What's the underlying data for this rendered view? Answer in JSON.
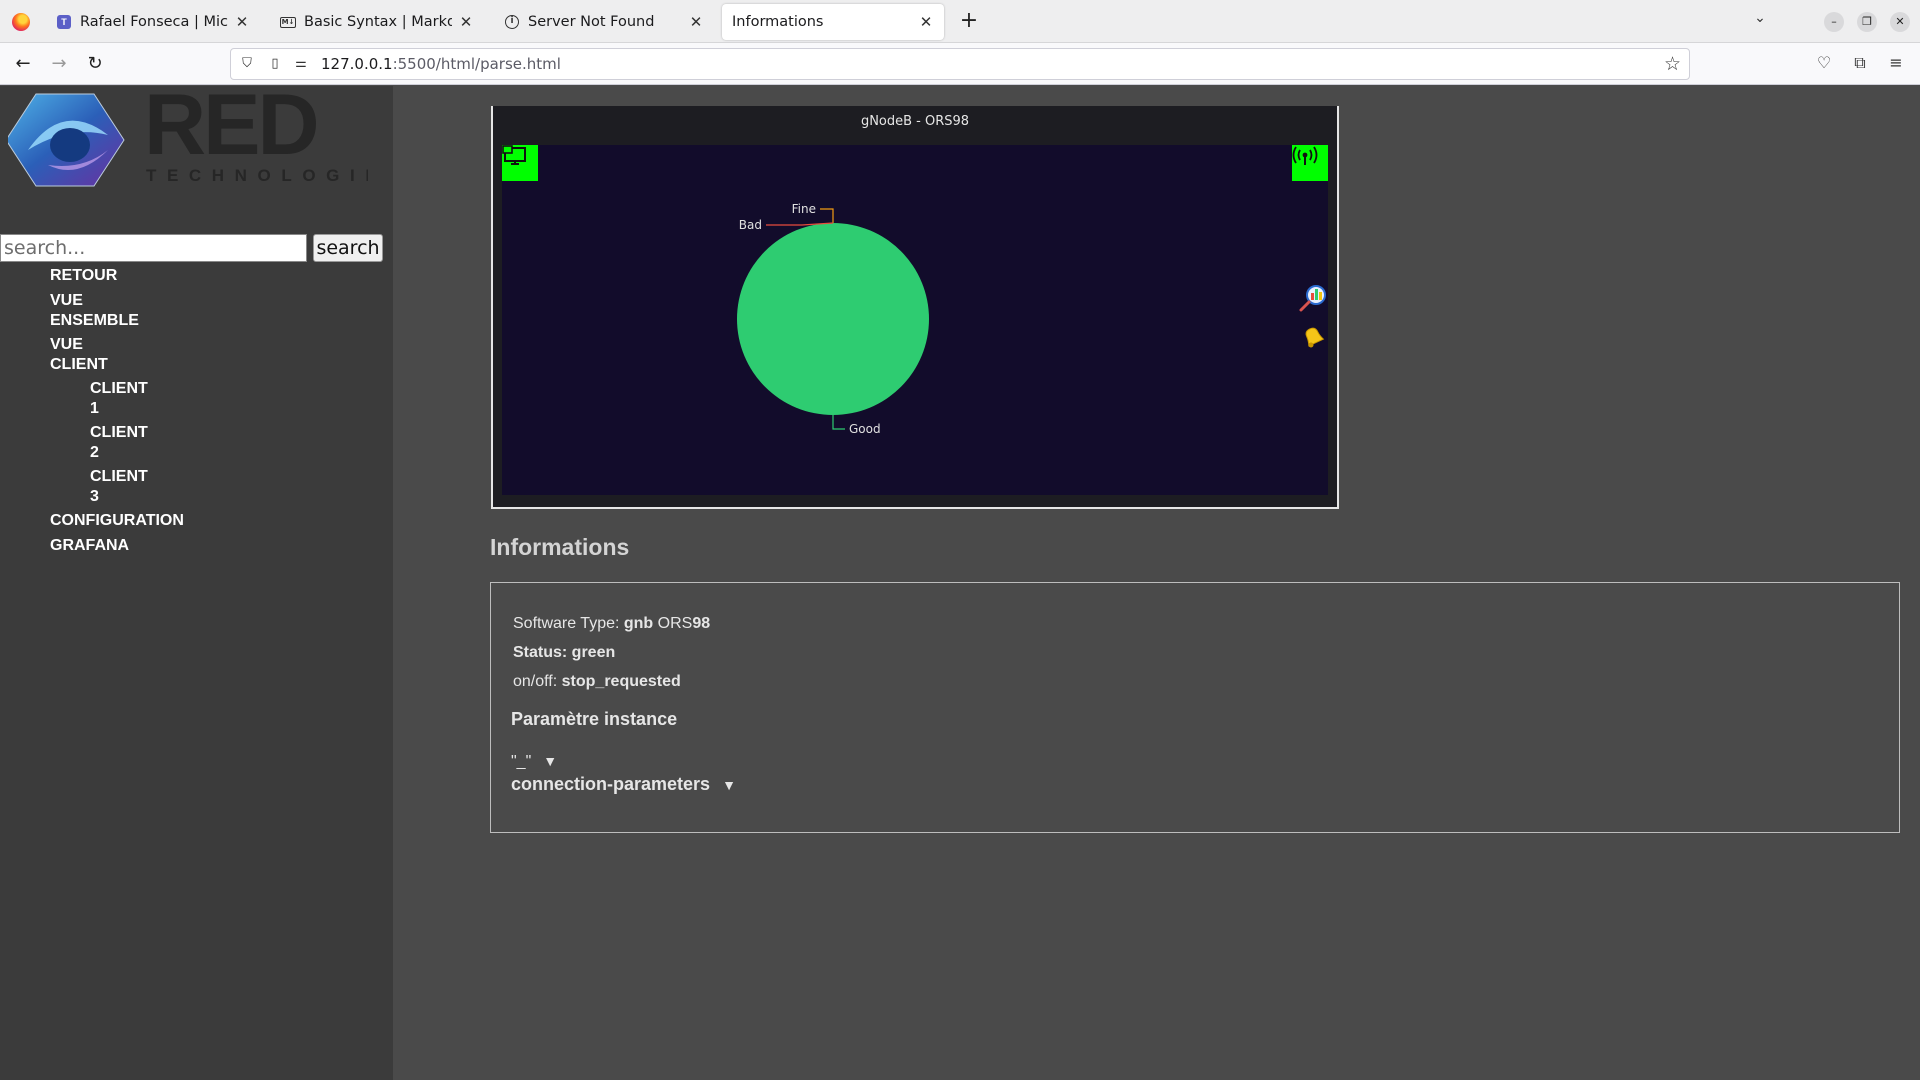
{
  "browser": {
    "tabs": [
      {
        "title": "Rafael Fonseca | Microsof",
        "icon": "teams-icon"
      },
      {
        "title": "Basic Syntax | Markdown",
        "icon": "markdown-icon"
      },
      {
        "title": "Server Not Found",
        "icon": "info-icon"
      },
      {
        "title": "Informations",
        "icon": "none",
        "active": true
      }
    ],
    "url_host": "127.0.0.1",
    "url_path": ":5500/html/parse.html"
  },
  "sidebar": {
    "logo_text": "RED",
    "logo_subtext": "TECHNOLOGIES",
    "search_placeholder": "search...",
    "search_button": "search",
    "menu": [
      {
        "label": "RETOUR",
        "level": 0
      },
      {
        "label": "VUE\nENSEMBLE",
        "level": 0
      },
      {
        "label": "VUE\nCLIENT",
        "level": 0
      },
      {
        "label": "CLIENT\n1",
        "level": 1
      },
      {
        "label": "CLIENT\n2",
        "level": 1
      },
      {
        "label": "CLIENT\n3",
        "level": 1
      },
      {
        "label": "CONFIGURATION",
        "level": 0
      },
      {
        "label": "GRAFANA",
        "level": 0
      }
    ]
  },
  "dashboard": {
    "title": "gNodeB - ORS98",
    "left_icon": "monitor-icon",
    "right_icon": "antenna-icon",
    "side_icons": [
      "chart-magnifier-icon",
      "bell-icon"
    ],
    "colors": {
      "button_green": "#00ff00",
      "plot_bg": "#120c2b",
      "pie_green": "#2ecc71"
    }
  },
  "chart_data": {
    "type": "pie",
    "categories": [
      "Good",
      "Fine",
      "Bad"
    ],
    "values": [
      1,
      0,
      0
    ],
    "colors": [
      "#2ecc71",
      "#f39c12",
      "#e74c3c"
    ]
  },
  "informations": {
    "title": "Informations",
    "software_label": "Software Type: ",
    "software_bold": "gnb",
    "software_mid": " ORS",
    "software_num": "98",
    "status_label": "Status: ",
    "status_value": "green",
    "onoff_label": "on/off: ",
    "onoff_value": "stop_requested",
    "param_title": "Paramètre instance",
    "toggle1": "\"_\"",
    "toggle2": "connection-parameters",
    "arrow": "▼"
  }
}
